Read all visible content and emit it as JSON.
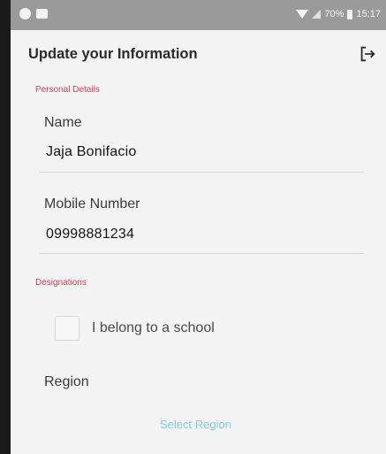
{
  "status_bar": {
    "battery": "70%",
    "time": "15:17"
  },
  "header": {
    "title": "Update your Information",
    "logout_icon": "logout-icon"
  },
  "personal_details": {
    "section_label": "Personal Details",
    "name_label": "Name",
    "name_value": "Jaja Bonifacio",
    "mobile_label": "Mobile Number",
    "mobile_value": "09998881234"
  },
  "designations": {
    "section_label": "Designations",
    "school_checkbox_label": "I belong to a school",
    "school_checked": false,
    "region_label": "Region",
    "region_select": "Select Region"
  },
  "colors": {
    "accent_red": "#e8385a",
    "link_blue": "#7fcdf3"
  }
}
